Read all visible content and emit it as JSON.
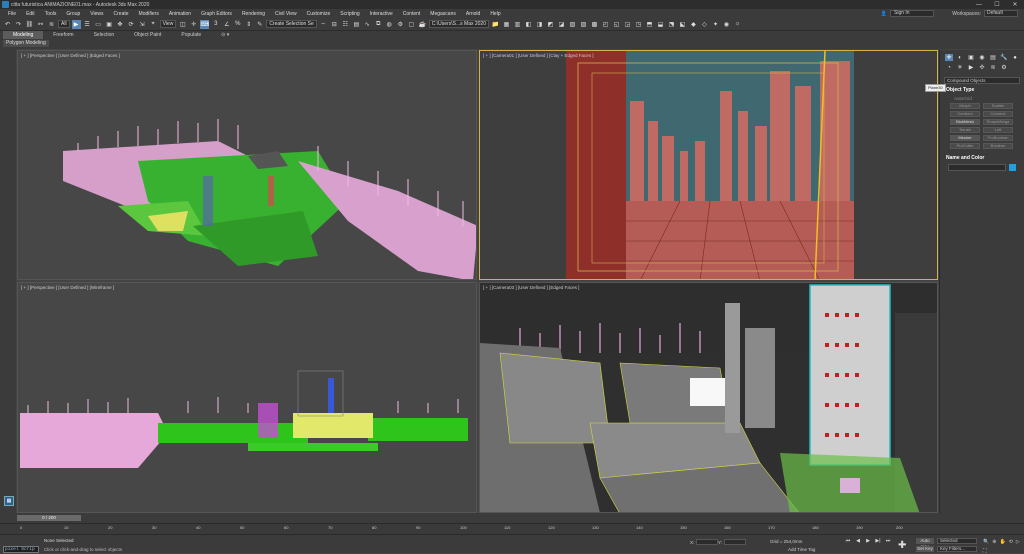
{
  "window": {
    "title": "citta futuristica ANIMAZIONE01.max - Autodesk 3ds Max 2020",
    "controls": [
      "—",
      "☐",
      "✕"
    ]
  },
  "menu": [
    "File",
    "Edit",
    "Tools",
    "Group",
    "Views",
    "Create",
    "Modifiers",
    "Animation",
    "Graph Editors",
    "Rendering",
    "Civil View",
    "Customize",
    "Scripting",
    "Interactive",
    "Content",
    "Megascans",
    "Arnold",
    "Help"
  ],
  "account": {
    "sign_in": "Sign In",
    "workspace_label": "Workspaces:",
    "workspace_value": "Default"
  },
  "toolbar": {
    "filter_value": "All",
    "view_value": "View",
    "selection_set": "Create Selection Se",
    "path": "C:\\Users\\S...s Max 2020"
  },
  "ribbon": {
    "tabs": [
      "Modeling",
      "Freeform",
      "Selection",
      "Object Paint",
      "Populate"
    ],
    "panel": "Polygon Modeling"
  },
  "viewports": {
    "top_left": "[ + ] [Perspective ] [User Defined ] [Edged Faces ]",
    "top_right": "[ + ] [Camera01 ] [User Defined ] [Clay + Edged Faces ]",
    "bottom_left": "[ + ] [Perspective ] [User Defined ] [Wireframe ]",
    "bottom_right": "[ + ] [Camera03 ] [User Defined ] [Edged Faces ]"
  },
  "command_panel": {
    "category": "Compound Objects",
    "rollout_object_type": "Object Type",
    "autogrid": "AutoGrid",
    "buttons": [
      {
        "label": "Morph",
        "enabled": false
      },
      {
        "label": "Scatter",
        "enabled": false
      },
      {
        "label": "Conform",
        "enabled": false
      },
      {
        "label": "Connect",
        "enabled": false
      },
      {
        "label": "BlobMesh",
        "enabled": true
      },
      {
        "label": "ShapeMerge",
        "enabled": false
      },
      {
        "label": "Terrain",
        "enabled": false
      },
      {
        "label": "Loft",
        "enabled": false
      },
      {
        "label": "Mesher",
        "enabled": true
      },
      {
        "label": "ProBoolean",
        "enabled": false
      },
      {
        "label": "ProCutter",
        "enabled": false
      },
      {
        "label": "Boolean",
        "enabled": false
      }
    ],
    "rollout_name_color": "Name and Color",
    "tooltip": "Plane30",
    "swatch_color": "#1fa0e0"
  },
  "timeline": {
    "slider": "0 / 200",
    "ticks": [
      "0",
      "10",
      "20",
      "30",
      "40",
      "50",
      "60",
      "70",
      "80",
      "90",
      "100",
      "110",
      "120",
      "130",
      "140",
      "150",
      "160",
      "170",
      "180",
      "190",
      "200"
    ]
  },
  "status": {
    "maxscript": "pixel Scrip",
    "selection": "None Selected",
    "prompt": "Click or click-and-drag to select objects",
    "x_label": "X:",
    "y_label": "Y:",
    "z_label": "Z:",
    "grid": "Grid = 254,0mm",
    "add_time_tag": "Add Time Tag",
    "auto_key": "Auto Key",
    "set_key": "Set Key",
    "selected": "Selected",
    "key_filters": "Key Filters..."
  },
  "colors": {
    "accent": "#5a86b8",
    "camera_border": "#d2b24b",
    "clay": "#b0504a"
  }
}
